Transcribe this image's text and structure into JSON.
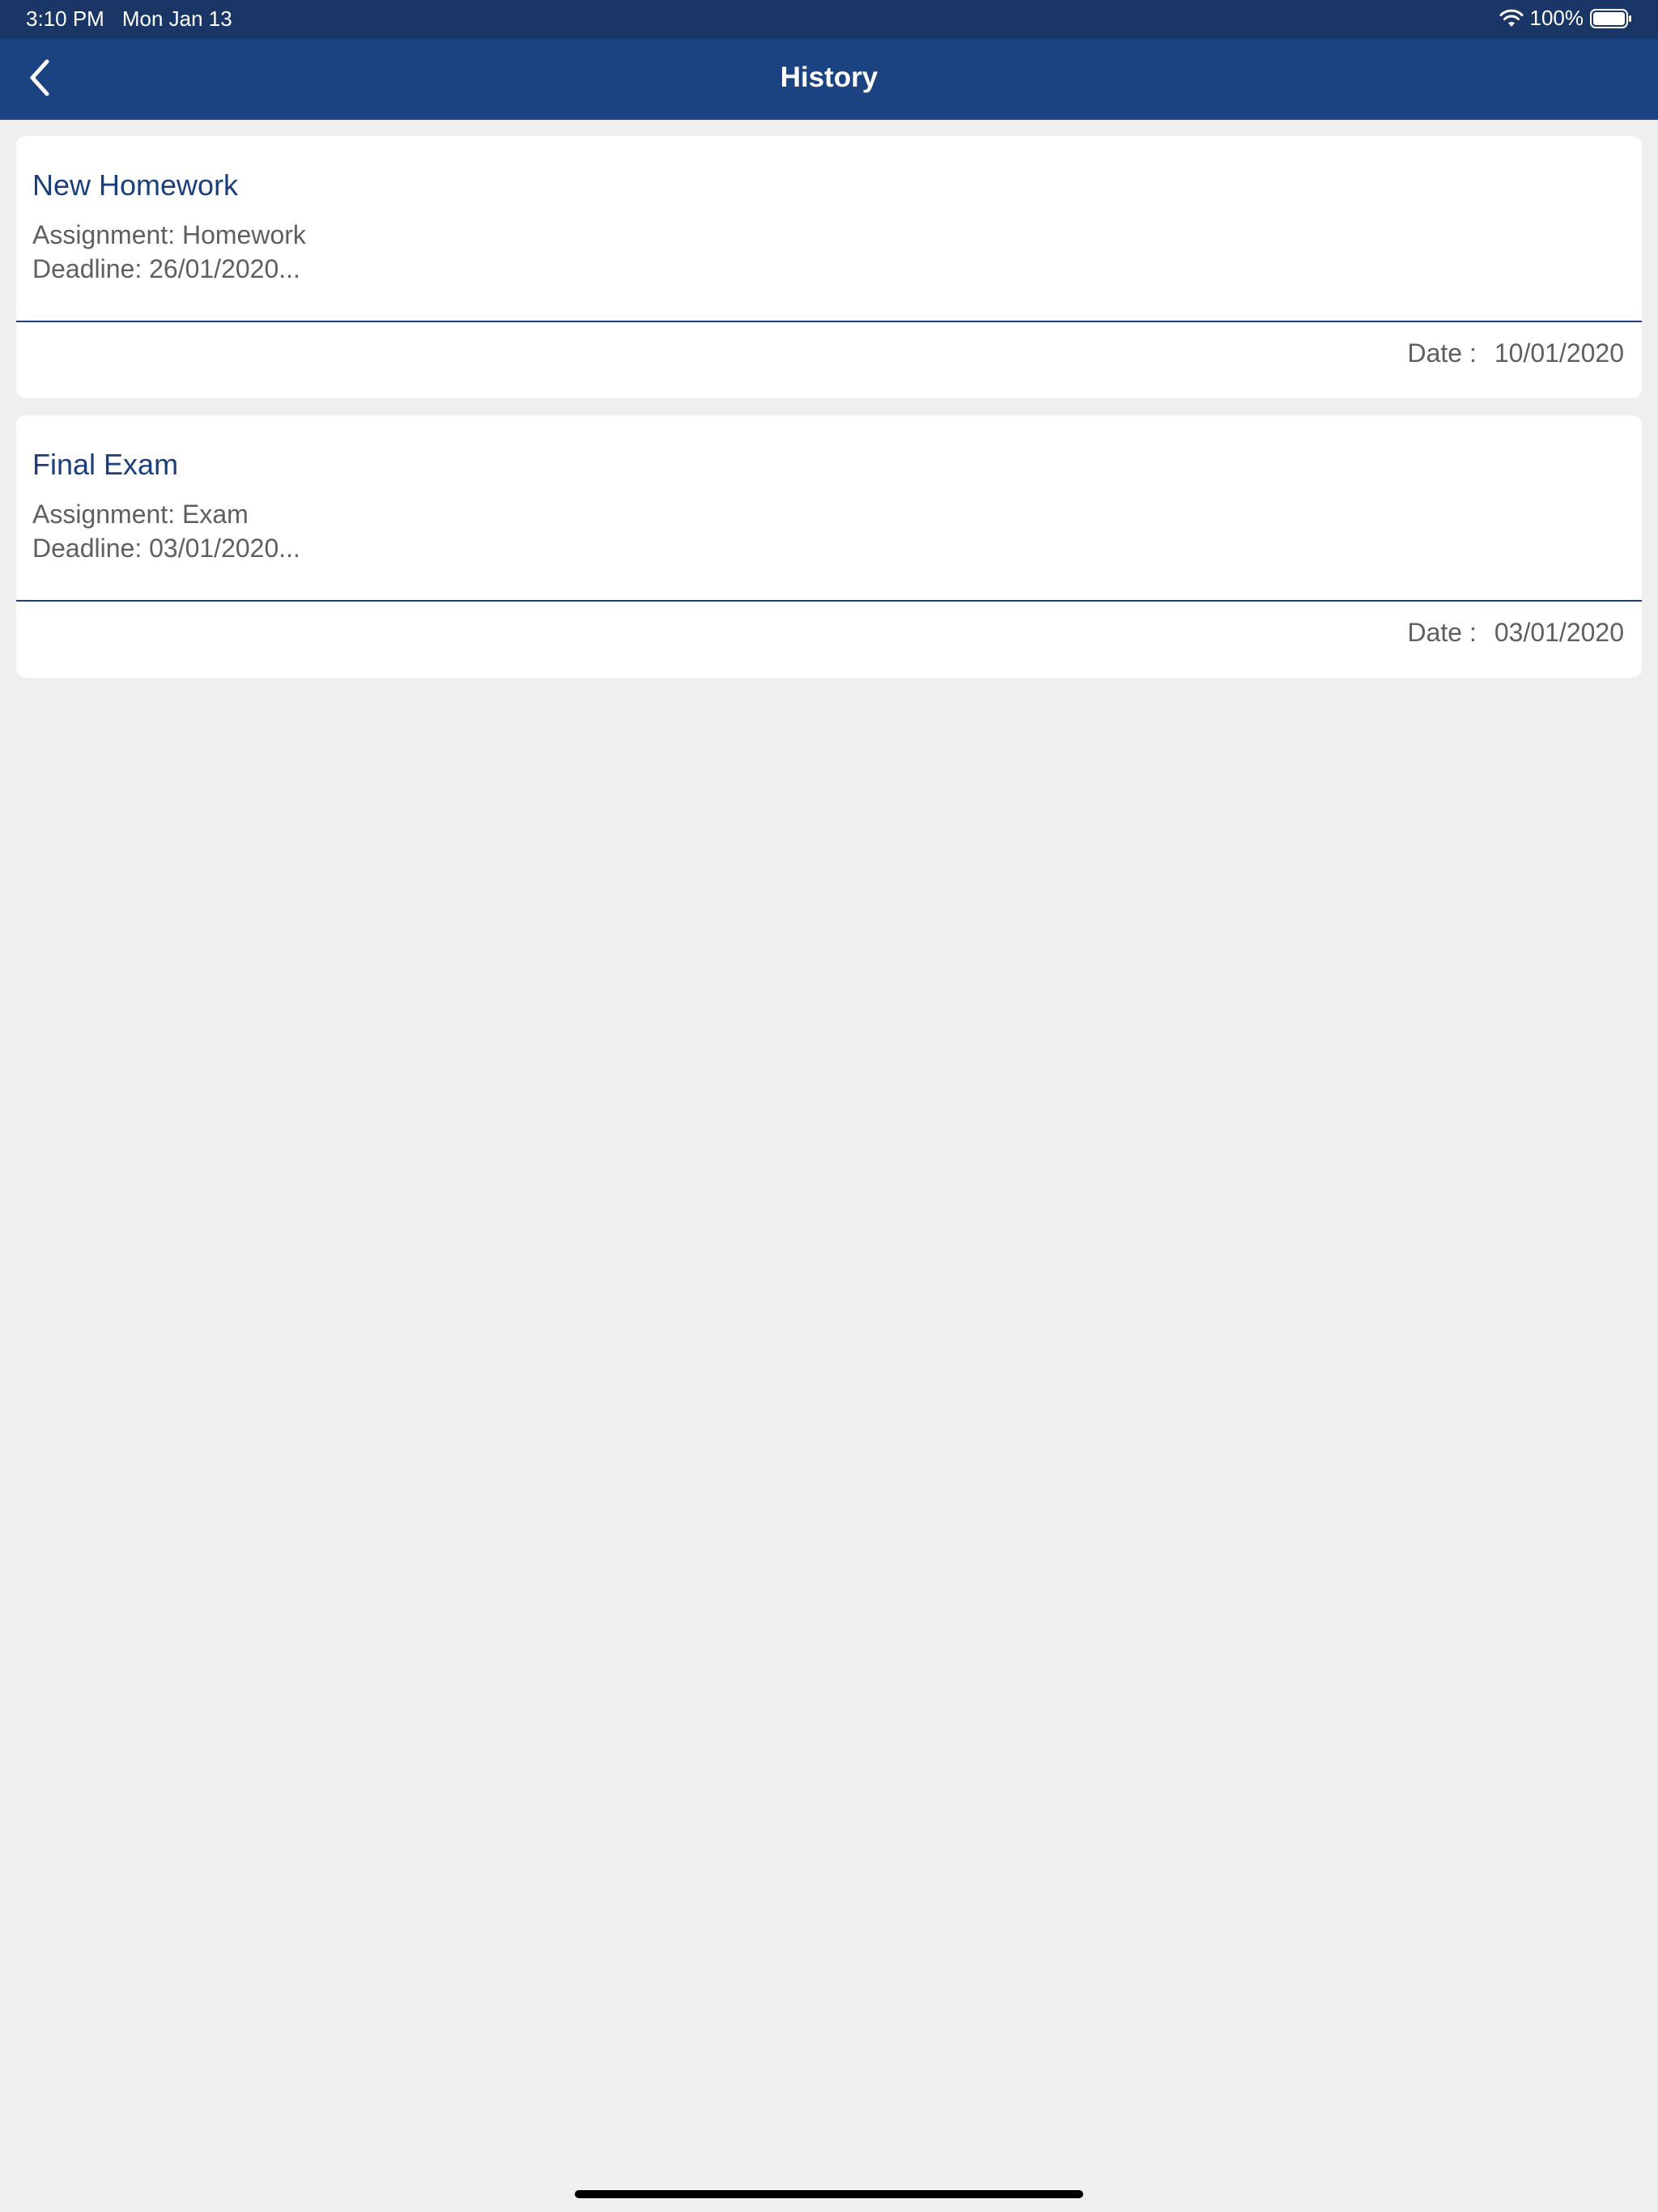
{
  "status_bar": {
    "time": "3:10 PM",
    "date": "Mon Jan 13",
    "battery": "100%",
    "wifi_icon": "wifi-icon",
    "battery_icon": "battery-icon"
  },
  "nav": {
    "title": "History",
    "back_icon": "chevron-left-icon"
  },
  "cards": [
    {
      "title": "New Homework",
      "assignment": "Assignment: Homework",
      "deadline": "Deadline: 26/01/2020...",
      "date_label": "Date :",
      "date_value": "10/01/2020"
    },
    {
      "title": "Final Exam",
      "assignment": "Assignment: Exam",
      "deadline": "Deadline: 03/01/2020...",
      "date_label": "Date :",
      "date_value": "03/01/2020"
    }
  ],
  "colors": {
    "status_bar": "#1a3666",
    "nav_bar": "#1b4382",
    "accent": "#1b3f7c",
    "background": "#efefef"
  }
}
